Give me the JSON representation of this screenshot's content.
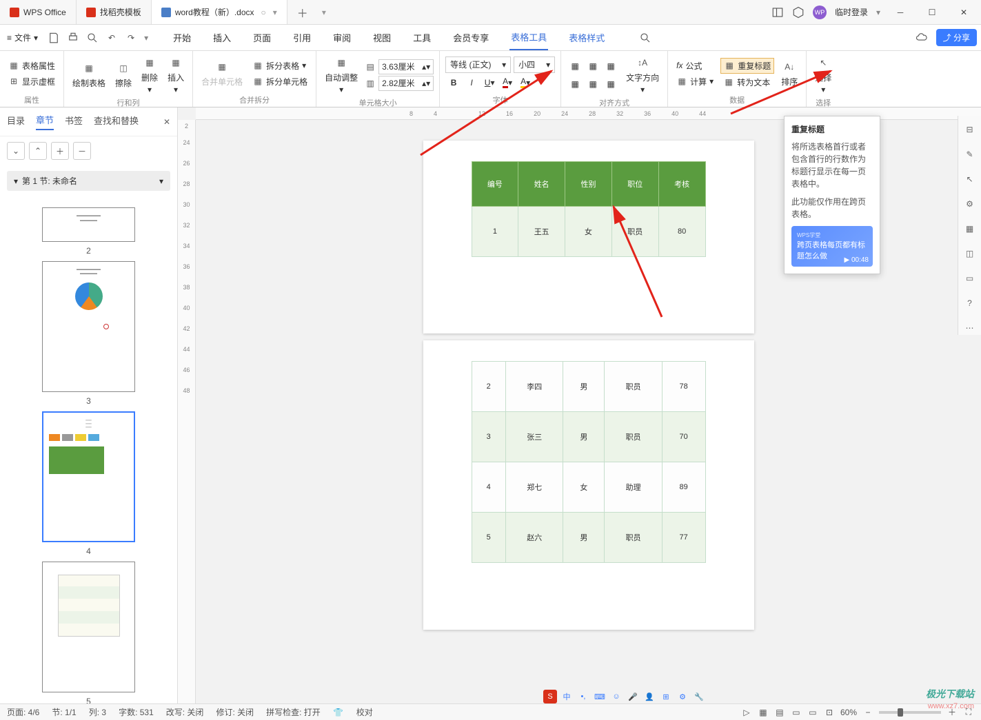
{
  "titlebar": {
    "app_name": "WPS Office",
    "tab2": "找稻壳模板",
    "tab3": "word教程（新）.docx",
    "login": "临时登录"
  },
  "menubar": {
    "file": "文件",
    "tabs": [
      "开始",
      "插入",
      "页面",
      "引用",
      "审阅",
      "视图",
      "工具",
      "会员专享",
      "表格工具",
      "表格样式"
    ],
    "share": "分享"
  },
  "ribbon": {
    "g1": {
      "b1": "表格属性",
      "b2": "显示虚框",
      "label": "属性"
    },
    "g2": {
      "b1": "绘制表格",
      "b2": "擦除",
      "b3": "删除",
      "b4": "插入",
      "label": "行和列"
    },
    "g3": {
      "b1": "合并单元格",
      "b2": "拆分表格",
      "b3": "拆分单元格",
      "label": "合并拆分"
    },
    "g4": {
      "b1": "自动调整",
      "w": "3.63厘米",
      "h": "2.82厘米",
      "label": "单元格大小"
    },
    "g5": {
      "font": "等线 (正文)",
      "size": "小四",
      "label": "字体"
    },
    "g6": {
      "dir": "文字方向",
      "label": "对齐方式"
    },
    "g7": {
      "b1": "公式",
      "b2": "计算",
      "label": "数据",
      "b3": "重复标题",
      "b4": "转为文本",
      "b5": "排序"
    },
    "g8": {
      "b1": "选择",
      "label": "选择"
    }
  },
  "left_panel": {
    "tabs": [
      "目录",
      "章节",
      "书签",
      "查找和替换"
    ],
    "section": "第 1 节: 未命名",
    "thumb_nums": [
      "2",
      "3",
      "4",
      "5"
    ]
  },
  "ruler_h": [
    "8",
    "4",
    "",
    "",
    "12",
    "16",
    "20",
    "24",
    "28",
    "32",
    "36",
    "40",
    "44"
  ],
  "ruler_v": [
    "2",
    "24",
    "26",
    "28",
    "30",
    "32",
    "34",
    "36",
    "38",
    "40",
    "42",
    "44",
    "46",
    "48"
  ],
  "table": {
    "headers": [
      "编号",
      "姓名",
      "性别",
      "职位",
      "考核"
    ],
    "rows1": [
      [
        "1",
        "王五",
        "女",
        "职员",
        "80"
      ]
    ],
    "rows2": [
      [
        "2",
        "李四",
        "男",
        "职员",
        "78"
      ],
      [
        "3",
        "张三",
        "男",
        "职员",
        "70"
      ],
      [
        "4",
        "郑七",
        "女",
        "助理",
        "89"
      ],
      [
        "5",
        "赵六",
        "男",
        "职员",
        "77"
      ]
    ]
  },
  "tooltip": {
    "title": "重复标题",
    "text1": "将所选表格首行或者包含首行的行数作为标题行显示在每一页表格中。",
    "text2": "此功能仅作用在跨页表格。",
    "video_title": "跨页表格每页都有标题怎么做",
    "video_time": "00:48"
  },
  "statusbar": {
    "page": "页面: 4/6",
    "section": "节: 1/1",
    "col": "列: 3",
    "words": "字数: 531",
    "rev": "改写: 关闭",
    "track": "修订: 关闭",
    "spell": "拼写检查: 打开",
    "proof": "校对",
    "zoom": "60%"
  },
  "watermark": "极光下载站",
  "watermark2": "www.xz7.com"
}
